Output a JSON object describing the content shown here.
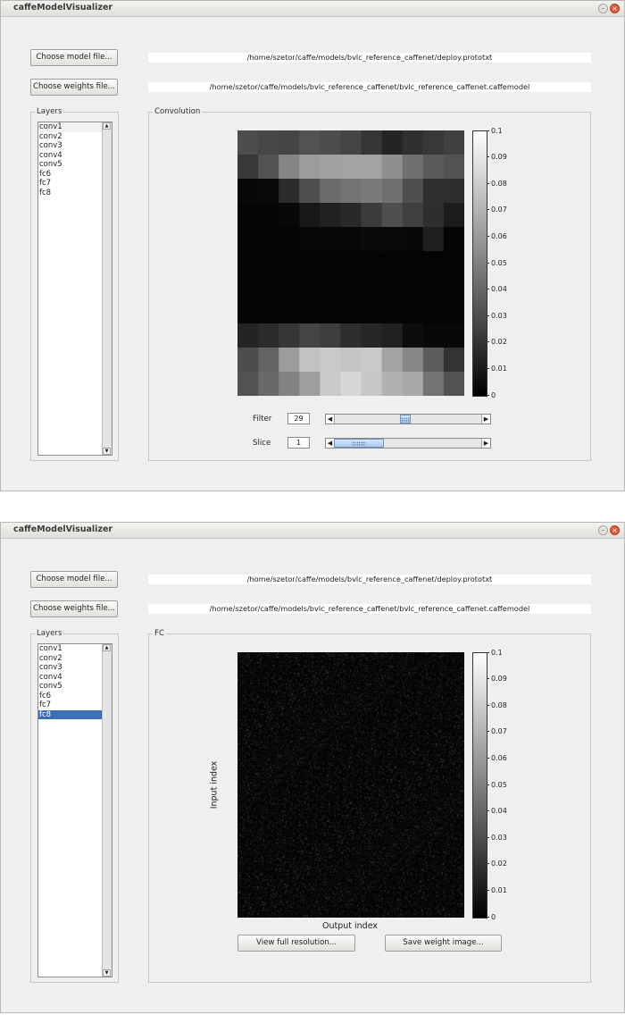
{
  "windows": [
    {
      "title": "caffeModelVisualizer",
      "choose_model_label": "Choose model file...",
      "model_path": "/home/szetor/caffe/models/bvlc_reference_caffenet/deploy.prototxt",
      "choose_weights_label": "Choose weights file...",
      "weights_path": "/home/szetor/caffe/models/bvlc_reference_caffenet/bvlc_reference_caffenet.caffemodel",
      "layers_label": "Layers",
      "layers": [
        "conv1",
        "conv2",
        "conv3",
        "conv4",
        "conv5",
        "fc6",
        "fc7",
        "fc8"
      ],
      "selected_layer": "conv1",
      "panel_label": "Convolution",
      "filter_label": "Filter",
      "filter_value": "29",
      "filter_slider_fraction": 0.48,
      "slice_label": "Slice",
      "slice_value": "1",
      "slice_slider_fraction": 0.0
    },
    {
      "title": "caffeModelVisualizer",
      "choose_model_label": "Choose model file...",
      "model_path": "/home/szetor/caffe/models/bvlc_reference_caffenet/deploy.prototxt",
      "choose_weights_label": "Choose weights file...",
      "weights_path": "/home/szetor/caffe/models/bvlc_reference_caffenet/bvlc_reference_caffenet.caffemodel",
      "layers_label": "Layers",
      "layers": [
        "conv1",
        "conv2",
        "conv3",
        "conv4",
        "conv5",
        "fc6",
        "fc7",
        "fc8"
      ],
      "selected_layer": "fc8",
      "panel_label": "FC",
      "xlabel": "Output index",
      "ylabel": "Input index",
      "view_full_label": "View full resolution...",
      "save_image_label": "Save weight image..."
    }
  ],
  "colors": {
    "window_bg": "#efefef",
    "selection": "#3c6eb4",
    "slider_thumb": "#a8c7ec"
  },
  "chart_data": [
    {
      "type": "heatmap",
      "title": "",
      "xlabel": "",
      "ylabel": "",
      "colormap": "gray",
      "colorbar_range": [
        0,
        0.1
      ],
      "colorbar_ticks": [
        "0.1",
        "0.09",
        "0.08",
        "0.07",
        "0.06",
        "0.05",
        "0.04",
        "0.03",
        "0.02",
        "0.01",
        "0"
      ],
      "rows": 11,
      "cols": 11,
      "values": [
        [
          0.03,
          0.028,
          0.027,
          0.032,
          0.03,
          0.027,
          0.021,
          0.014,
          0.019,
          0.022,
          0.025
        ],
        [
          0.022,
          0.032,
          0.052,
          0.061,
          0.063,
          0.064,
          0.064,
          0.056,
          0.044,
          0.035,
          0.032
        ],
        [
          0.003,
          0.004,
          0.017,
          0.031,
          0.042,
          0.045,
          0.048,
          0.044,
          0.031,
          0.019,
          0.018
        ],
        [
          0.002,
          0.002,
          0.003,
          0.009,
          0.013,
          0.016,
          0.023,
          0.031,
          0.025,
          0.018,
          0.011
        ],
        [
          0.002,
          0.002,
          0.002,
          0.003,
          0.003,
          0.003,
          0.004,
          0.004,
          0.003,
          0.012,
          0.002
        ],
        [
          0.002,
          0.002,
          0.002,
          0.002,
          0.002,
          0.002,
          0.002,
          0.002,
          0.002,
          0.002,
          0.002
        ],
        [
          0.002,
          0.002,
          0.002,
          0.002,
          0.002,
          0.002,
          0.002,
          0.002,
          0.002,
          0.002,
          0.002
        ],
        [
          0.002,
          0.002,
          0.002,
          0.002,
          0.002,
          0.002,
          0.002,
          0.002,
          0.002,
          0.002,
          0.002
        ],
        [
          0.014,
          0.017,
          0.021,
          0.027,
          0.024,
          0.018,
          0.015,
          0.013,
          0.005,
          0.003,
          0.003
        ],
        [
          0.03,
          0.039,
          0.061,
          0.076,
          0.079,
          0.077,
          0.079,
          0.064,
          0.053,
          0.036,
          0.02
        ],
        [
          0.032,
          0.041,
          0.051,
          0.062,
          0.079,
          0.084,
          0.078,
          0.069,
          0.066,
          0.045,
          0.032
        ]
      ]
    },
    {
      "type": "heatmap",
      "title": "",
      "xlabel": "Output index",
      "ylabel": "Input index",
      "colormap": "gray",
      "colorbar_range": [
        0,
        0.1
      ],
      "colorbar_ticks": [
        "0.1",
        "0.09",
        "0.08",
        "0.07",
        "0.06",
        "0.05",
        "0.04",
        "0.03",
        "0.02",
        "0.01",
        "0"
      ],
      "distribution": "noise",
      "typical_value": 0.005,
      "max_value": 0.03
    }
  ]
}
